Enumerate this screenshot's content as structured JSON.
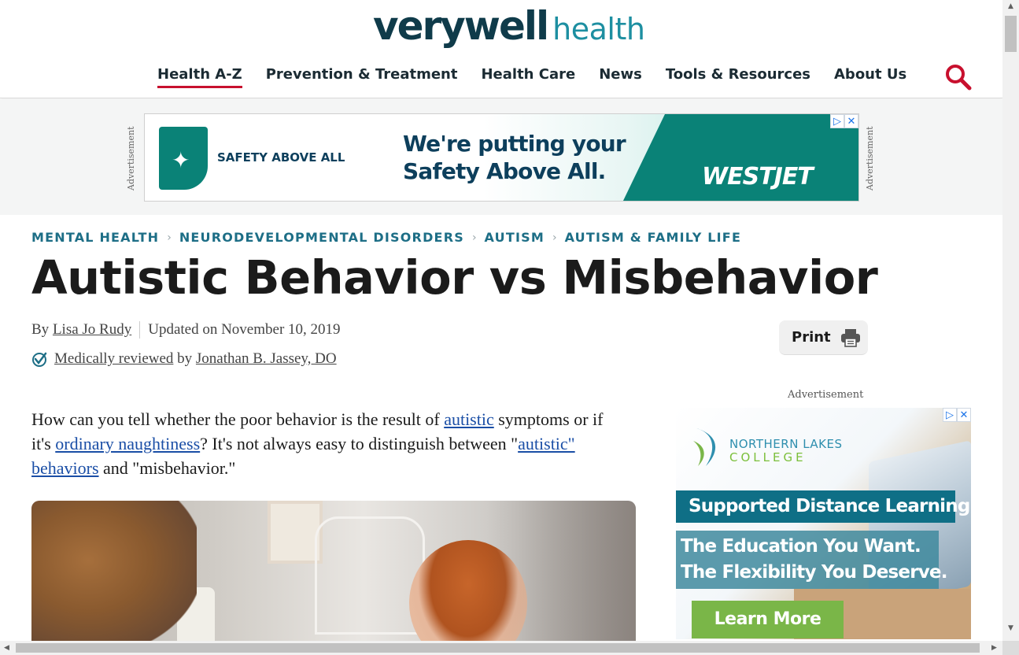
{
  "site": {
    "logo_bold": "verywell",
    "logo_light": "health"
  },
  "nav": {
    "items": [
      {
        "label": "Health A-Z",
        "active": true
      },
      {
        "label": "Prevention & Treatment",
        "active": false
      },
      {
        "label": "Health Care",
        "active": false
      },
      {
        "label": "News",
        "active": false
      },
      {
        "label": "Tools & Resources",
        "active": false
      },
      {
        "label": "About Us",
        "active": false
      }
    ],
    "search_icon": "search-icon",
    "accent_color": "#c8102e"
  },
  "top_ad": {
    "side_label": "Advertisement",
    "safety_text": "SAFETY ABOVE ALL",
    "headline_line1": "We're putting your",
    "headline_line2": "Safety Above All.",
    "brand": "WESTJET",
    "brand_color": "#0a8277",
    "adchoices_icon": "ⓘ",
    "close_icon": "✕"
  },
  "breadcrumb": [
    "MENTAL HEALTH",
    "NEURODEVELOPMENTAL DISORDERS",
    "AUTISM",
    "AUTISM & FAMILY LIFE"
  ],
  "article": {
    "title": "Autistic Behavior vs Misbehavior",
    "by_prefix": "By",
    "author": "Lisa Jo Rudy",
    "updated": "Updated on November 10, 2019",
    "reviewed_link": "Medically reviewed",
    "reviewed_by_prefix": "by",
    "reviewer": "Jonathan B. Jassey, DO",
    "print_label": "Print",
    "intro": {
      "part1": "How can you tell whether the poor behavior is the result of ",
      "link1": "autistic",
      "part2": " symptoms or if it's ",
      "link2": "ordinary naughtiness",
      "part3": "? It's not always easy to distinguish between \"",
      "link3": "autistic\" behaviors",
      "part4": " and \"misbehavior.\""
    }
  },
  "side_ad": {
    "label": "Advertisement",
    "college_line1": "NORTHERN LAKES",
    "college_line2": "COLLEGE",
    "band1": "Supported Distance Learning",
    "band2_line1": "The Education You Want.",
    "band2_line2": "The Flexibility You Deserve.",
    "cta": "Learn More",
    "cta_color": "#7ab648"
  }
}
